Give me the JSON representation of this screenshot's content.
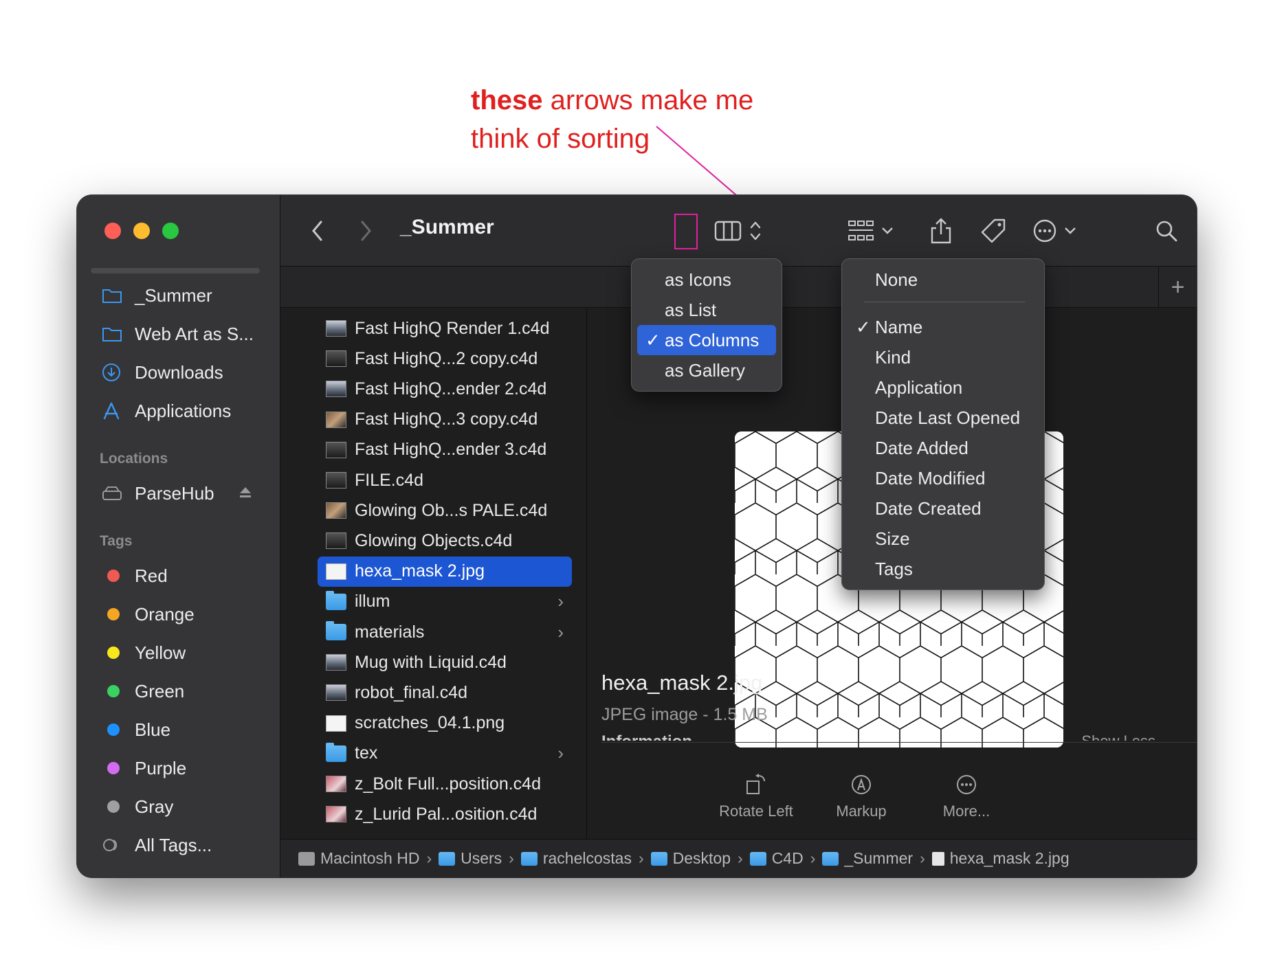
{
  "annotation": {
    "bold": "these",
    "line1_rest": " arrows make me",
    "line2": "think of sorting"
  },
  "window": {
    "title": "_Summer",
    "traffic_colors": [
      "#fe5f57",
      "#febc2e",
      "#28c840"
    ]
  },
  "sidebar": {
    "favorites": [
      {
        "label": "_Summer",
        "icon": "folder-icon"
      },
      {
        "label": "Web Art as S...",
        "icon": "folder-icon"
      },
      {
        "label": "Downloads",
        "icon": "download-icon"
      },
      {
        "label": "Applications",
        "icon": "applications-icon"
      }
    ],
    "locations_heading": "Locations",
    "locations": [
      {
        "label": "ParseHub",
        "icon": "drive-icon"
      }
    ],
    "tags_heading": "Tags",
    "tags": [
      {
        "label": "Red",
        "color": "#f05a52"
      },
      {
        "label": "Orange",
        "color": "#f5a623"
      },
      {
        "label": "Yellow",
        "color": "#f8e71c"
      },
      {
        "label": "Green",
        "color": "#3ad160"
      },
      {
        "label": "Blue",
        "color": "#1e90ff"
      },
      {
        "label": "Purple",
        "color": "#d36cf0"
      },
      {
        "label": "Gray",
        "color": "#a0a0a0"
      },
      {
        "label": "All Tags...",
        "color": ""
      }
    ]
  },
  "files": [
    {
      "name": "Fast HighQ Render 1.c4d",
      "icon": "thumb"
    },
    {
      "name": "Fast HighQ...2 copy.c4d",
      "icon": "thumb dark"
    },
    {
      "name": "Fast HighQ...ender 2.c4d",
      "icon": "thumb"
    },
    {
      "name": "Fast HighQ...3 copy.c4d",
      "icon": "thumb warm"
    },
    {
      "name": "Fast HighQ...ender 3.c4d",
      "icon": "thumb dark"
    },
    {
      "name": "FILE.c4d",
      "icon": "thumb dark"
    },
    {
      "name": "Glowing Ob...s PALE.c4d",
      "icon": "thumb warm"
    },
    {
      "name": "Glowing Objects.c4d",
      "icon": "thumb dark"
    },
    {
      "name": "hexa_mask 2.jpg",
      "icon": "thumb white",
      "selected": true
    },
    {
      "name": "illum",
      "icon": "folder",
      "folder": true
    },
    {
      "name": "materials",
      "icon": "folder",
      "folder": true
    },
    {
      "name": "Mug with Liquid.c4d",
      "icon": "thumb"
    },
    {
      "name": "robot_final.c4d",
      "icon": "thumb"
    },
    {
      "name": "scratches_04.1.png",
      "icon": "thumb white"
    },
    {
      "name": "tex",
      "icon": "folder",
      "folder": true
    },
    {
      "name": "z_Bolt Full...position.c4d",
      "icon": "thumb red"
    },
    {
      "name": "z_Lurid Pal...osition.c4d",
      "icon": "thumb red"
    }
  ],
  "view_menu": {
    "items": [
      "as Icons",
      "as List",
      "as Columns",
      "as Gallery"
    ],
    "selected_index": 2,
    "check": "✓"
  },
  "sort_menu": {
    "none_label": "None",
    "items": [
      "Name",
      "Kind",
      "Application",
      "Date Last Opened",
      "Date Added",
      "Date Modified",
      "Date Created",
      "Size",
      "Tags"
    ],
    "selected_index": 0,
    "check": "✓"
  },
  "preview": {
    "name": "hexa_mask 2.jpg",
    "kind": "JPEG image - 1.5 MB",
    "info_heading": "Information",
    "show_more": "Show Less",
    "actions": [
      {
        "label": "Rotate Left",
        "icon": "rotate-left-icon"
      },
      {
        "label": "Markup",
        "icon": "markup-icon"
      },
      {
        "label": "More...",
        "icon": "more-icon"
      }
    ]
  },
  "pathbar": [
    {
      "label": "Macintosh HD",
      "icon": "hard-drive-icon"
    },
    {
      "label": "Users",
      "icon": "folder-icon"
    },
    {
      "label": "rachelcostas",
      "icon": "home-folder-icon"
    },
    {
      "label": "Desktop",
      "icon": "folder-icon"
    },
    {
      "label": "C4D",
      "icon": "folder-icon"
    },
    {
      "label": "_Summer",
      "icon": "folder-icon"
    },
    {
      "label": "hexa_mask 2.jpg",
      "icon": "file-icon"
    }
  ],
  "tab_add": "+"
}
